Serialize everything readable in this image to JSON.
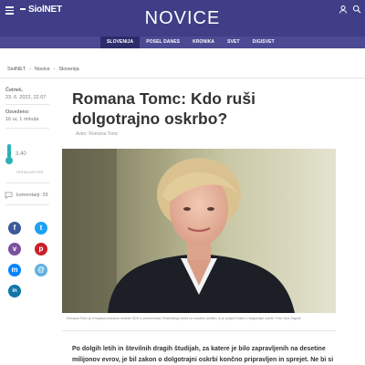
{
  "header": {
    "logo": "SiolNET",
    "brand": "NOVICE"
  },
  "nav": {
    "items": [
      "SLOVENIJA",
      "POSEL DANES",
      "KRONIKA",
      "SVET",
      "DIGISVET"
    ],
    "active": "SLOVENIJA"
  },
  "breadcrumb": [
    "SiolNET",
    "Novice",
    "Slovenija"
  ],
  "meta": {
    "date": "Četrtek,",
    "date_full": "23. 6. 2022, 22.07",
    "updated_label": "Osveženo:",
    "updated_value": "16 ur, 1 minuta",
    "temperature": "3,40",
    "temperature_label": "TERMOMETER",
    "comments": "komentarji: 39"
  },
  "article": {
    "title": "Romana Tomc: Kdo ruši dolgotrajno oskrbo?",
    "author": "Avtor: Romana Tomc",
    "caption": "Romana Tomc je evropska poslanka stranke SDS in predsednica Strateškega sveta za socialno politiko, ki je podpril Zakon o dolgotrajni oskrbi. Foto: Ana Grgurič",
    "lead": "Po dolgih letih in številnih dragih študijah, za katere je bilo zapravljenih na desetine milijonov evrov, je bil zakon o dolgotrajni oskrbi končno pripravljen in sprejet. Ne bi si mislili, koliko"
  },
  "share": [
    {
      "icon": "facebook-icon",
      "glyph": "f",
      "color": "#3b5998"
    },
    {
      "icon": "twitter-icon",
      "glyph": "t",
      "color": "#1da1f2"
    },
    {
      "icon": "viber-icon",
      "glyph": "v",
      "color": "#7b519d"
    },
    {
      "icon": "pinterest-icon",
      "glyph": "p",
      "color": "#cb2027"
    },
    {
      "icon": "messenger-icon",
      "glyph": "m",
      "color": "#0084ff"
    },
    {
      "icon": "mail-icon",
      "glyph": "@",
      "color": "#5fb0e0"
    },
    {
      "icon": "linkedin-icon",
      "glyph": "in",
      "color": "#0e76a8"
    }
  ],
  "colors": {
    "header_bg": "#3f3e86",
    "nav_bg": "#4b4a93",
    "nav_active": "#2d2c6a",
    "accent_teal": "#2ab1b5"
  }
}
